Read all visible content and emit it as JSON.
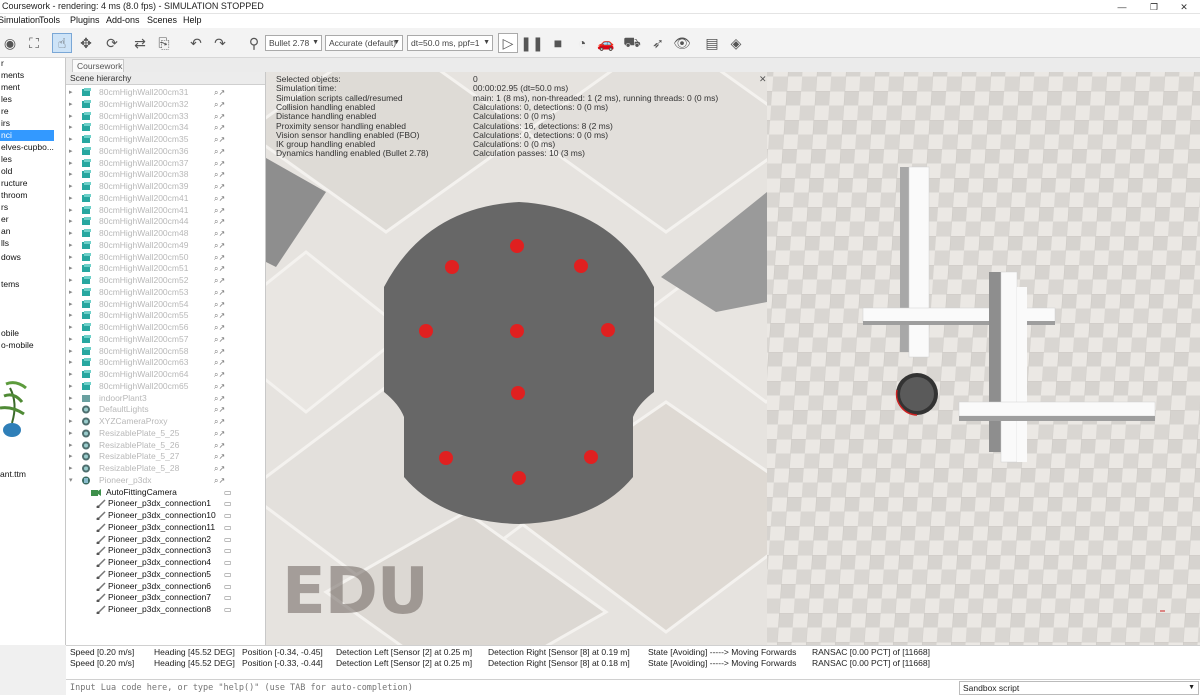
{
  "window": {
    "title": "Coursework - rendering: 4 ms (8.0 fps) - SIMULATION STOPPED",
    "minimize": "—",
    "maximize": "❐",
    "close": "✕"
  },
  "menu": [
    "Simulation",
    "Tools",
    "Plugins",
    "Add-ons",
    "Scenes",
    "Help"
  ],
  "toolbar": {
    "engine": "Bullet 2.78",
    "accuracy": "Accurate (default)",
    "timestep": "dt=50.0 ms, ppf=1"
  },
  "left_panel": {
    "items": [
      "r",
      "ments",
      "ment",
      "les",
      "re",
      "irs",
      "nci",
      "elves-cupbo...",
      "les",
      "old",
      "ructure",
      "throom",
      "rs",
      "er",
      "an",
      "lls",
      "dows",
      "",
      "tems",
      "",
      "",
      "",
      "obile",
      "o-mobile"
    ],
    "selected_index": 6,
    "plant_label": "ant.ttm"
  },
  "tab": "Coursework",
  "hierarchy": {
    "header": "Scene hierarchy",
    "rows": [
      {
        "name": "80cmHighWall200cm31",
        "icon": "cube"
      },
      {
        "name": "80cmHighWall200cm32",
        "icon": "cube"
      },
      {
        "name": "80cmHighWall200cm33",
        "icon": "cube"
      },
      {
        "name": "80cmHighWall200cm34",
        "icon": "cube"
      },
      {
        "name": "80cmHighWall200cm35",
        "icon": "cube"
      },
      {
        "name": "80cmHighWall200cm36",
        "icon": "cube"
      },
      {
        "name": "80cmHighWall200cm37",
        "icon": "cube"
      },
      {
        "name": "80cmHighWall200cm38",
        "icon": "cube"
      },
      {
        "name": "80cmHighWall200cm39",
        "icon": "cube"
      },
      {
        "name": "80cmHighWall200cm41",
        "icon": "cube"
      },
      {
        "name": "80cmHighWall200cm41",
        "icon": "cube"
      },
      {
        "name": "80cmHighWall200cm44",
        "icon": "cube"
      },
      {
        "name": "80cmHighWall200cm48",
        "icon": "cube"
      },
      {
        "name": "80cmHighWall200cm49",
        "icon": "cube"
      },
      {
        "name": "80cmHighWall200cm50",
        "icon": "cube"
      },
      {
        "name": "80cmHighWall200cm51",
        "icon": "cube"
      },
      {
        "name": "80cmHighWall200cm52",
        "icon": "cube"
      },
      {
        "name": "80cmHighWall200cm53",
        "icon": "cube"
      },
      {
        "name": "80cmHighWall200cm54",
        "icon": "cube"
      },
      {
        "name": "80cmHighWall200cm55",
        "icon": "cube"
      },
      {
        "name": "80cmHighWall200cm56",
        "icon": "cube"
      },
      {
        "name": "80cmHighWall200cm57",
        "icon": "cube"
      },
      {
        "name": "80cmHighWall200cm58",
        "icon": "cube"
      },
      {
        "name": "80cmHighWall200cm63",
        "icon": "cube"
      },
      {
        "name": "80cmHighWall200cm64",
        "icon": "cube"
      },
      {
        "name": "80cmHighWall200cm65",
        "icon": "cube"
      },
      {
        "name": "indoorPlant3",
        "icon": "shape"
      },
      {
        "name": "DefaultLights",
        "icon": "light"
      },
      {
        "name": "XYZCameraProxy",
        "icon": "light"
      },
      {
        "name": "ResizablePlate_5_25",
        "icon": "light"
      },
      {
        "name": "ResizablePlate_5_26",
        "icon": "light"
      },
      {
        "name": "ResizablePlate_5_27",
        "icon": "light"
      },
      {
        "name": "ResizablePlate_5_28",
        "icon": "light"
      },
      {
        "name": "Pioneer_p3dx",
        "icon": "robot"
      },
      {
        "name": "AutoFittingCamera",
        "icon": "camera",
        "dark": true
      },
      {
        "name": "Pioneer_p3dx_connection1",
        "icon": "joint",
        "dark": true
      },
      {
        "name": "Pioneer_p3dx_connection10",
        "icon": "joint",
        "dark": true
      },
      {
        "name": "Pioneer_p3dx_connection11",
        "icon": "joint",
        "dark": true
      },
      {
        "name": "Pioneer_p3dx_connection2",
        "icon": "joint",
        "dark": true
      },
      {
        "name": "Pioneer_p3dx_connection3",
        "icon": "joint",
        "dark": true
      },
      {
        "name": "Pioneer_p3dx_connection4",
        "icon": "joint",
        "dark": true
      },
      {
        "name": "Pioneer_p3dx_connection5",
        "icon": "joint",
        "dark": true
      },
      {
        "name": "Pioneer_p3dx_connection6",
        "icon": "joint",
        "dark": true
      },
      {
        "name": "Pioneer_p3dx_connection7",
        "icon": "joint",
        "dark": true
      },
      {
        "name": "Pioneer_p3dx_connection8",
        "icon": "joint",
        "dark": true
      }
    ]
  },
  "info": [
    {
      "label": "Selected objects:",
      "value": "0"
    },
    {
      "label": "Simulation time:",
      "value": "00:00:02.95 (dt=50.0 ms)"
    },
    {
      "label": "Simulation scripts called/resumed",
      "value": "main: 1 (8 ms), non-threaded: 1 (2 ms), running threads: 0 (0 ms)"
    },
    {
      "label": "Collision handling enabled",
      "value": "Calculations: 0, detections: 0 (0 ms)"
    },
    {
      "label": "Distance handling enabled",
      "value": "Calculations: 0 (0 ms)"
    },
    {
      "label": "Proximity sensor handling enabled",
      "value": "Calculations: 16, detections: 8 (2 ms)"
    },
    {
      "label": "Vision sensor handling enabled (FBO)",
      "value": "Calculations: 0, detections: 0 (0 ms)"
    },
    {
      "label": "IK group handling enabled",
      "value": "Calculations: 0 (0 ms)"
    },
    {
      "label": "Dynamics handling enabled (Bullet 2.78)",
      "value": "Calculation passes: 10 (3 ms)"
    }
  ],
  "watermark": "EDU",
  "status_lines": [
    {
      "speed": "Speed [0.20 m/s]",
      "heading": "Heading [45.52 DEG]",
      "position": "Position [-0.34, -0.45]",
      "det_left": "Detection Left [Sensor [2] at 0.25 m]",
      "det_right": "Detection Right [Sensor [8] at 0.19 m]",
      "state": "State [Avoiding] -----> Moving Forwards",
      "ransac": "RANSAC [0.00 PCT] of [11668]"
    },
    {
      "speed": "Speed [0.20 m/s]",
      "heading": "Heading [45.52 DEG]",
      "position": "Position [-0.33, -0.44]",
      "det_left": "Detection Left [Sensor [2] at 0.25 m]",
      "det_right": "Detection Right [Sensor [8] at 0.18 m]",
      "state": "State [Avoiding] -----> Moving Forwards",
      "ransac": "RANSAC [0.00 PCT] of [11668]"
    }
  ],
  "command": {
    "placeholder": "Input Lua code here, or type \"help()\" (use TAB for auto-completion)",
    "script_selector": "Sandbox script"
  },
  "colors": {
    "robot_body": "#666666",
    "sensor": "#e02020",
    "selection": "#3399ff",
    "floor_light": "#e8e6e3",
    "floor_dark": "#cfccc8"
  }
}
